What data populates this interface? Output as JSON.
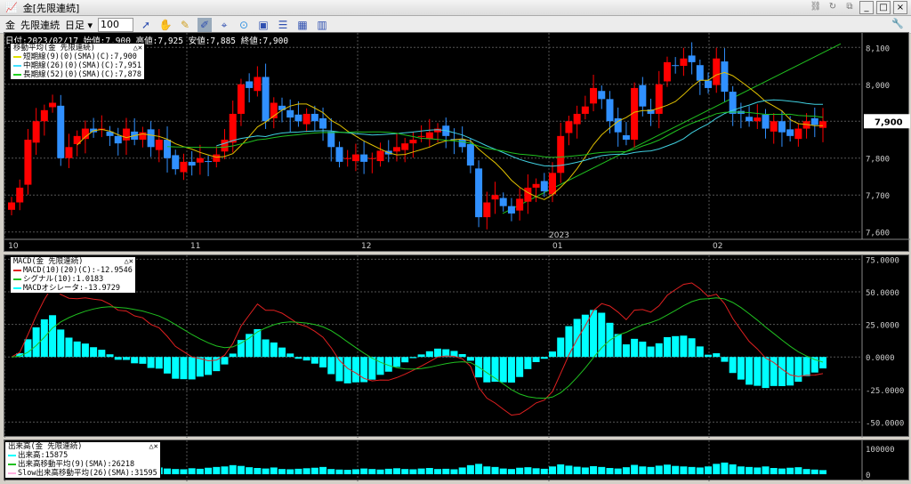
{
  "window": {
    "title": "金[先限連続]",
    "icons": [
      "link-icon",
      "refresh-icon",
      "copy-icon"
    ],
    "buttons": [
      "_",
      "□",
      "×"
    ]
  },
  "toolbar": {
    "symbol": "金",
    "contract": "先限連続",
    "period": "日足 ▾",
    "count": "100",
    "tools": [
      "cursor-icon",
      "hand-icon",
      "pencil-icon",
      "draw-icon",
      "crosshair-icon",
      "up-icon",
      "chart-icon",
      "grid-icon",
      "table-icon",
      "bar-chart-icon"
    ]
  },
  "info": "日付:2023/02/17 始値:7,900 高値:7,925 安値:7,885 終値:7,900",
  "ma_legend": {
    "title": "移動平均(金 先限連続)",
    "rows": [
      {
        "label": "短期線(9)(0)(SMA)(C):7,900",
        "color": "#e0e000"
      },
      {
        "label": "中期線(26)(0)(SMA)(C):7,951",
        "color": "#40e0ff"
      },
      {
        "label": "長期線(52)(0)(SMA)(C):7,878",
        "color": "#20d020"
      }
    ]
  },
  "macd_legend": {
    "title": "MACD(金 先限連続)",
    "rows": [
      {
        "label": "MACD(10)(20)(C):-12.9546",
        "color": "#e02020"
      },
      {
        "label": "シグナル(10):1.0183",
        "color": "#20c020"
      },
      {
        "label": "MACDオシレータ:-13.9729",
        "color": "#00ffff"
      }
    ]
  },
  "vol_legend": {
    "title": "出来高(金 先限連続)",
    "rows": [
      {
        "label": "出来高:15875",
        "color": "#00ffff"
      },
      {
        "label": "出来高移動平均(9)(SMA):26218",
        "color": "#20c020"
      },
      {
        "label": "Slow出来高移動平均(26)(SMA):31595",
        "color": "#ffb0e0"
      }
    ]
  },
  "price_axis": [
    "8,100",
    "8,000",
    "7,900",
    "7,800",
    "7,700",
    "7,600"
  ],
  "current_price": "7,900",
  "date_labels": [
    "10",
    "11",
    "12",
    "01",
    "02"
  ],
  "year_label": "2023",
  "macd_axis": [
    "75.0000",
    "50.0000",
    "25.0000",
    "0.0000",
    "-25.0000",
    "-50.0000"
  ],
  "vol_axis": [
    "100000",
    "0"
  ],
  "colors": {
    "up": "#ff0000",
    "down": "#3090ff",
    "bg": "#000000"
  },
  "chart_data": {
    "type": "candlestick",
    "closes": [
      7680,
      7720,
      7850,
      7900,
      7930,
      7950,
      7800,
      7830,
      7860,
      7880,
      7870,
      7880,
      7860,
      7840,
      7880,
      7850,
      7870,
      7830,
      7850,
      7800,
      7770,
      7790,
      7780,
      7800,
      7790,
      7810,
      7850,
      7920,
      8000,
      7990,
      8020,
      7900,
      7950,
      7930,
      7910,
      7900,
      7920,
      7900,
      7880,
      7830,
      7790,
      7800,
      7810,
      7790,
      7800,
      7820,
      7810,
      7830,
      7840,
      7850,
      7860,
      7870,
      7880,
      7860,
      7850,
      7830,
      7780,
      7640,
      7680,
      7700,
      7670,
      7650,
      7690,
      7720,
      7730,
      7710,
      7760,
      7860,
      7900,
      7920,
      7940,
      7990,
      7960,
      7900,
      7870,
      7850,
      7990,
      7940,
      7920,
      8000,
      8060,
      8050,
      8070,
      8060,
      8010,
      7990,
      8070,
      7980,
      7920,
      7920,
      7900,
      7910,
      7880,
      7900,
      7870,
      7860,
      7880,
      7900,
      7890,
      7900
    ],
    "volumes": [
      30000,
      22000,
      25000,
      28000,
      24000,
      26000,
      20000,
      18000,
      22000,
      25000,
      21000,
      19000,
      23000,
      27000,
      20000,
      18000,
      17000,
      24000,
      26000,
      22000,
      20000,
      19000,
      23000,
      21000,
      25000,
      28000,
      30000,
      35000,
      32000,
      27000,
      24000,
      22000,
      26000,
      20000,
      19000,
      21000,
      23000,
      25000,
      28000,
      20000,
      18000,
      17000,
      19000,
      22000,
      20000,
      18000,
      21000,
      23000,
      20000,
      19000,
      22000,
      24000,
      20000,
      21000,
      19000,
      26000,
      35000,
      40000,
      30000,
      28000,
      22000,
      20000,
      25000,
      27000,
      23000,
      21000,
      30000,
      38000,
      33000,
      29000,
      26000,
      31000,
      28000,
      24000,
      22000,
      27000,
      36000,
      30000,
      28000,
      33000,
      37000,
      32000,
      30000,
      28000,
      26000,
      30000,
      40000,
      45000,
      38000,
      30000,
      28000,
      26000,
      30000,
      24000,
      22000,
      25000,
      27000,
      20000,
      18000,
      15875
    ],
    "price_range": [
      7580,
      8120
    ],
    "macd_range": [
      -62000,
      78000
    ],
    "vol_range": [
      0,
      110000
    ]
  }
}
